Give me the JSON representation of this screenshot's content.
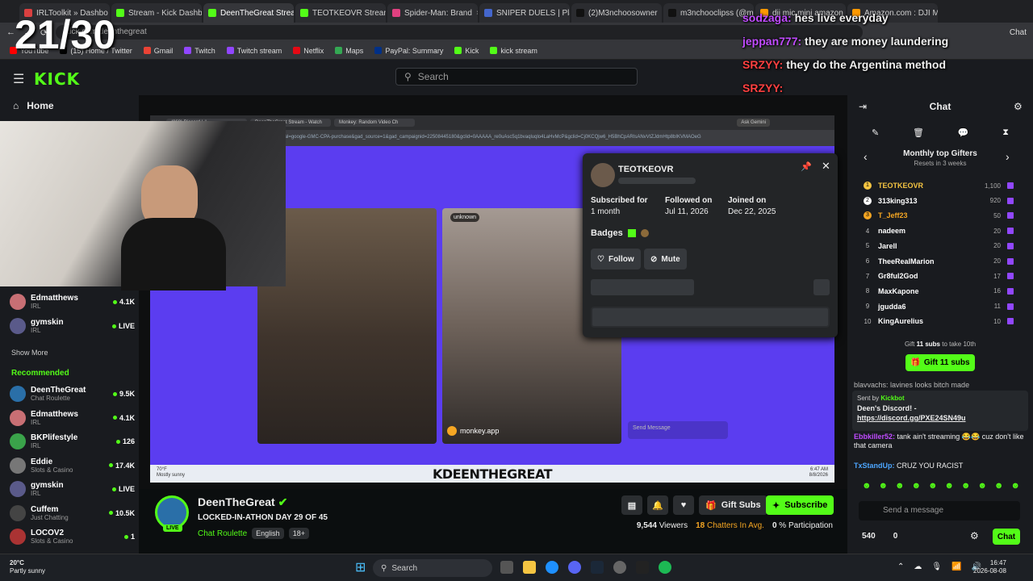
{
  "browser": {
    "tabs": [
      {
        "label": "IRLToolkit » Dashbo",
        "color": "#d94040"
      },
      {
        "label": "Stream - Kick Dashb",
        "color": "#53fc18"
      },
      {
        "label": "DeenTheGreat Strea",
        "color": "#53fc18",
        "active": true
      },
      {
        "label": "TEOTKEOVR Stream",
        "color": "#53fc18"
      },
      {
        "label": "Spider-Man: Brand",
        "color": "#e04080"
      },
      {
        "label": "SNIPER DUELS | Pla",
        "color": "#4466cc"
      },
      {
        "label": "(2)M3nchoosowner",
        "color": "#111111"
      },
      {
        "label": "m3nchooclipss (@m",
        "color": "#111111"
      },
      {
        "label": "dji mic mini amazon",
        "color": "#ff9900"
      },
      {
        "label": "Amazon.com : DJI M",
        "color": "#ff9900"
      }
    ],
    "url": "kick.com/deenthegreat",
    "profile_label": "Chat",
    "bookmarks": [
      "YouTube",
      "(15) Home / Twitter",
      "Gmail",
      "Twitch",
      "Twitch stream",
      "Netflix",
      "Maps",
      "PayPal: Summary",
      "Kick",
      "kick stream"
    ]
  },
  "overlay_counter": "21/30",
  "overlay_chat": [
    {
      "user": "sodzaga:",
      "text": "hes live everyday",
      "color": "#c04bff"
    },
    {
      "user": "jeppan777:",
      "text": "they are money laundering",
      "color": "#c04bff"
    },
    {
      "user": "SRZYY:",
      "text": "they do the Argentina method",
      "color": "#ff4040"
    },
    {
      "user": "SRZYY:",
      "text": "",
      "color": "#ff4040"
    }
  ],
  "kick": {
    "search_placeholder": "Search",
    "home_label": "Home",
    "sidebar_top": [
      {
        "name": "Edmatthews",
        "sub": "IRL",
        "viewers": "4.1K",
        "color": "#c86f74"
      },
      {
        "name": "gymskin",
        "sub": "IRL",
        "viewers": "LIVE",
        "color": "#5a5a8a"
      }
    ],
    "show_more": "Show More",
    "recommended_title": "Recommended",
    "recommended": [
      {
        "name": "DeenTheGreat",
        "sub": "Chat Roulette",
        "viewers": "9.5K",
        "color": "#2a6fa8"
      },
      {
        "name": "Edmatthews",
        "sub": "IRL",
        "viewers": "4.1K",
        "color": "#c86f74"
      },
      {
        "name": "BKPlifestyle",
        "sub": "IRL",
        "viewers": "126",
        "color": "#3aa34a"
      },
      {
        "name": "Eddie",
        "sub": "Slots & Casino",
        "viewers": "17.4K",
        "color": "#777777"
      },
      {
        "name": "gymskin",
        "sub": "IRL",
        "viewers": "LIVE",
        "color": "#5a5a8a"
      },
      {
        "name": "Cuffem",
        "sub": "Just Chatting",
        "viewers": "10.5K",
        "color": "#444444"
      },
      {
        "name": "LOCOV2",
        "sub": "Slots & Casino",
        "viewers": "1",
        "color": "#a33"
      }
    ]
  },
  "video": {
    "inner_tabs": [
      "(868) Discord | #",
      "DeenTheGreat Stream - Watch",
      "Monkey: Random Video Ch"
    ],
    "inner_url": "onal=google-GMC-CPA-purchase&gad_source=1&gad_campaignid=22508445180&gclid=0AAAAA_re0uAsc5q1bvaqluqlo4LaHvMcP&gclid=Cj0KCQjw6_H5BhCpARIsANvVtZJdmHtp8bIKVMAOeG",
    "ask_label": "Ask Gemini",
    "cam_right_user": "unknown",
    "monkey_label": "monkey.app",
    "send_message": "Send Message",
    "taskbar_title": "KDEENTHEGREAT",
    "weather": "70°F",
    "weather_sub": "Mostly sunny",
    "clock": "6:47 AM",
    "date": "8/8/2026"
  },
  "profile_card": {
    "username": "TEOTKEOVR",
    "subscribed_label": "Subscribed for",
    "subscribed_value": "1 month",
    "followed_label": "Followed on",
    "followed_value": "Jul 11, 2026",
    "joined_label": "Joined on",
    "joined_value": "Dec 22, 2025",
    "badges_label": "Badges",
    "follow_label": "Follow",
    "mute_label": "Mute"
  },
  "channel": {
    "name": "DeenTheGreat",
    "title": "LOCKED-IN-ATHON DAY 29 OF 45",
    "category": "Chat Roulette",
    "tags": [
      "English",
      "18+"
    ],
    "live_label": "LIVE",
    "gift_label": "Gift Subs",
    "subscribe_label": "Subscribe",
    "viewers": "9,544",
    "viewers_label": "Viewers",
    "chatters": "18",
    "chatters_label": "Chatters In Avg.",
    "participation": "0",
    "participation_label": "% Participation"
  },
  "chat": {
    "title": "Chat",
    "gifters_title": "Monthly top Gifters",
    "gifters_sub": "Resets in 3 weeks",
    "gifters": [
      {
        "rank": "1",
        "name": "TEOTKEOVR",
        "count": "1,100",
        "color": "#f5c542"
      },
      {
        "rank": "2",
        "name": "313king313",
        "count": "920",
        "color": "#ffffff"
      },
      {
        "rank": "3",
        "name": "T_Jeff23",
        "count": "50",
        "color": "#f5a623"
      },
      {
        "rank": "4",
        "name": "nadeem",
        "count": "20",
        "color": "#ffffff"
      },
      {
        "rank": "5",
        "name": "Jarell",
        "count": "20",
        "color": "#ffffff"
      },
      {
        "rank": "6",
        "name": "TheeRealMarion",
        "count": "20",
        "color": "#ffffff"
      },
      {
        "rank": "7",
        "name": "Gr8ful2God",
        "count": "17",
        "color": "#ffffff"
      },
      {
        "rank": "8",
        "name": "MaxKapone",
        "count": "16",
        "color": "#ffffff"
      },
      {
        "rank": "9",
        "name": "jgudda6",
        "count": "11",
        "color": "#ffffff"
      },
      {
        "rank": "10",
        "name": "KingAurelius",
        "count": "10",
        "color": "#ffffff"
      }
    ],
    "gift_prompt_pre": "Gift",
    "gift_prompt_count": "11 subs",
    "gift_prompt_post": "to take 10th",
    "gift_button": "Gift 11 subs",
    "partial_msg": "blavvachs: lavines looks bitch made",
    "pinned_sent_by": "Sent by",
    "pinned_user": "Kickbot",
    "pinned_text": "Deen's Discord! -",
    "pinned_link": "https://discord.gg/PXE24SN49u",
    "messages": [
      {
        "user": "Ebbkiller52:",
        "text": "tank ain't streaming 😂😂 cuz don't like that camera",
        "color": "#c04bff"
      },
      {
        "user": "TxStandUp:",
        "text": "CRUZ YOU RACIST",
        "color": "#4da6ff"
      }
    ],
    "input_placeholder": "Send a message",
    "points": "540",
    "kick_points": "0",
    "send_label": "Chat"
  },
  "windows": {
    "weather_temp": "20°C",
    "weather_text": "Partly sunny",
    "search": "Search",
    "time": "16:47",
    "date": "2026-08-08"
  }
}
